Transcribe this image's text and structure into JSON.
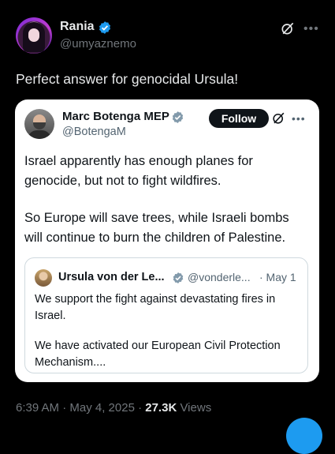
{
  "post": {
    "author_name": "Rania",
    "author_handle": "@umyaznemo",
    "text": "Perfect answer for genocidal Ursula!",
    "timestamp": "6:39 AM · May 4, 2025 · ",
    "views_count": "27.3K",
    "views_label": " Views"
  },
  "quoted": {
    "author_name": "Marc Botenga MEP",
    "author_handle": "@BotengaM",
    "follow_label": "Follow",
    "text_lines": [
      "Israel apparently has enough planes for",
      "genocide, but not to fight wildfires.",
      "So Europe will save trees, while Israeli  bombs",
      "will continue to burn the children of Palestine."
    ],
    "inner": {
      "author_name": "Ursula von der Le...",
      "author_handle": "@vonderle...",
      "date": "· May 1",
      "text_lines": [
        "We support the fight against devastating fires in",
        "Israel.",
        "We have activated our European Civil Protection",
        "Mechanism...."
      ]
    }
  },
  "colors": {
    "background": "#000000",
    "verified": "#1d9bf0",
    "muted": "#71767b",
    "card_text": "#0f1419"
  }
}
